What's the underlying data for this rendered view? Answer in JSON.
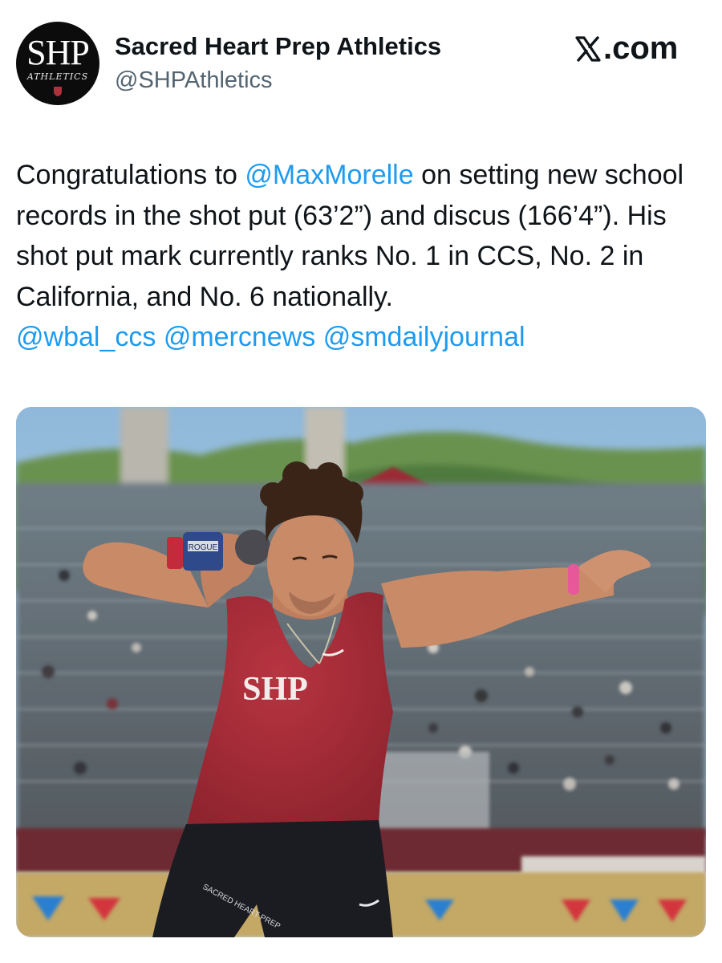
{
  "account": {
    "display_name": "Sacred Heart Prep Athletics",
    "handle": "@SHPAthletics",
    "avatar_monogram": "SHP",
    "avatar_subtitle": "ATHLETICS"
  },
  "site": {
    "label": ".com",
    "icon": "x-logo-icon"
  },
  "tweet": {
    "segment_1": "Congratulations to ",
    "mention_1": "@MaxMorelle",
    "segment_2": " on setting new school records in the shot put (63’2”) and discus (166’4”). His shot put mark currently ranks No. 1 in CCS, No. 2 in California, and No. 6 nationally.",
    "mention_2": "@wbal_ccs",
    "mention_3": "@mercnews",
    "mention_4": "@smdailyjournal"
  },
  "media": {
    "jersey_text": "SHP",
    "wrap_text": "ROGUE",
    "shorts_text": "SACRED HEART PREP",
    "colors": {
      "sky": "#9cc3e2",
      "hills": "#5f8a45",
      "jersey": "#9e2a35",
      "shorts": "#1b1b22",
      "skin": "#c98a68",
      "hair": "#3a2418",
      "wristband": "#e8579a",
      "track": "#bfa15a"
    }
  },
  "colors": {
    "text": "#0f1419",
    "secondary": "#536471",
    "link": "#1d9bf0"
  }
}
